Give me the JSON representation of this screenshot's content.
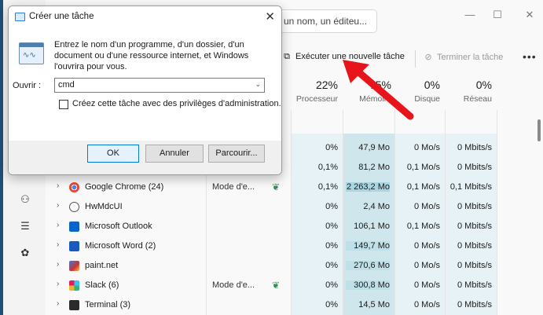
{
  "taskmgr": {
    "search": {
      "text": "un nom, un éditeu..."
    },
    "window_controls": {
      "minimize": "—",
      "maximize": "☐",
      "close": "✕"
    },
    "toolbar": {
      "run_new_task": "Exécuter une nouvelle tâche",
      "end_task": "Terminer la tâche",
      "more": "•••"
    },
    "columns": [
      {
        "pct": "22%",
        "label": "Processeur"
      },
      {
        "pct": "75%",
        "label": "Mémoire"
      },
      {
        "pct": "0%",
        "label": "Disque"
      },
      {
        "pct": "0%",
        "label": "Réseau"
      }
    ],
    "rows": [
      {
        "name": "",
        "status": "",
        "cpu": "0%",
        "mem": "47,9 Mo",
        "disk": "0 Mo/s",
        "net": "0 Mbits/s"
      },
      {
        "name": "",
        "status": "",
        "cpu": "0,1%",
        "mem": "81,2 Mo",
        "disk": "0,1 Mo/s",
        "net": "0 Mbits/s"
      },
      {
        "name": "Google Chrome (24)",
        "status": "Mode d'e...",
        "cpu": "0,1%",
        "mem": "2 263,2 Mo",
        "disk": "0,1 Mo/s",
        "net": "0,1 Mbits/s"
      },
      {
        "name": "HwMdcUI",
        "status": "",
        "cpu": "0%",
        "mem": "2,4 Mo",
        "disk": "0 Mo/s",
        "net": "0 Mbits/s"
      },
      {
        "name": "Microsoft Outlook",
        "status": "",
        "cpu": "0%",
        "mem": "106,1 Mo",
        "disk": "0,1 Mo/s",
        "net": "0 Mbits/s"
      },
      {
        "name": "Microsoft Word (2)",
        "status": "",
        "cpu": "0%",
        "mem": "149,7 Mo",
        "disk": "0 Mo/s",
        "net": "0 Mbits/s"
      },
      {
        "name": "paint.net",
        "status": "",
        "cpu": "0%",
        "mem": "270,6 Mo",
        "disk": "0 Mo/s",
        "net": "0 Mbits/s"
      },
      {
        "name": "Slack (6)",
        "status": "Mode d'e...",
        "cpu": "0%",
        "mem": "300,8 Mo",
        "disk": "0 Mo/s",
        "net": "0 Mbits/s"
      },
      {
        "name": "Terminal (3)",
        "status": "",
        "cpu": "0%",
        "mem": "14,5 Mo",
        "disk": "0 Mo/s",
        "net": "0 Mbits/s"
      }
    ]
  },
  "dialog": {
    "title": "Créer une tâche",
    "close": "✕",
    "description": "Entrez le nom d'un programme, d'un dossier, d'un document ou d'une ressource internet, et Windows l'ouvrira pour vous.",
    "open_label": "Ouvrir :",
    "open_value": "cmd",
    "admin_checkbox_label": "Créez cette tâche avec des privilèges d'administration.",
    "ok": "OK",
    "cancel": "Annuler",
    "browse": "Parcourir..."
  },
  "colors": {
    "accent": "#0078d4",
    "memory_fill": "#c9e3ea",
    "heat_fill": "#e3f1f4",
    "arrow": "#e8141b"
  }
}
